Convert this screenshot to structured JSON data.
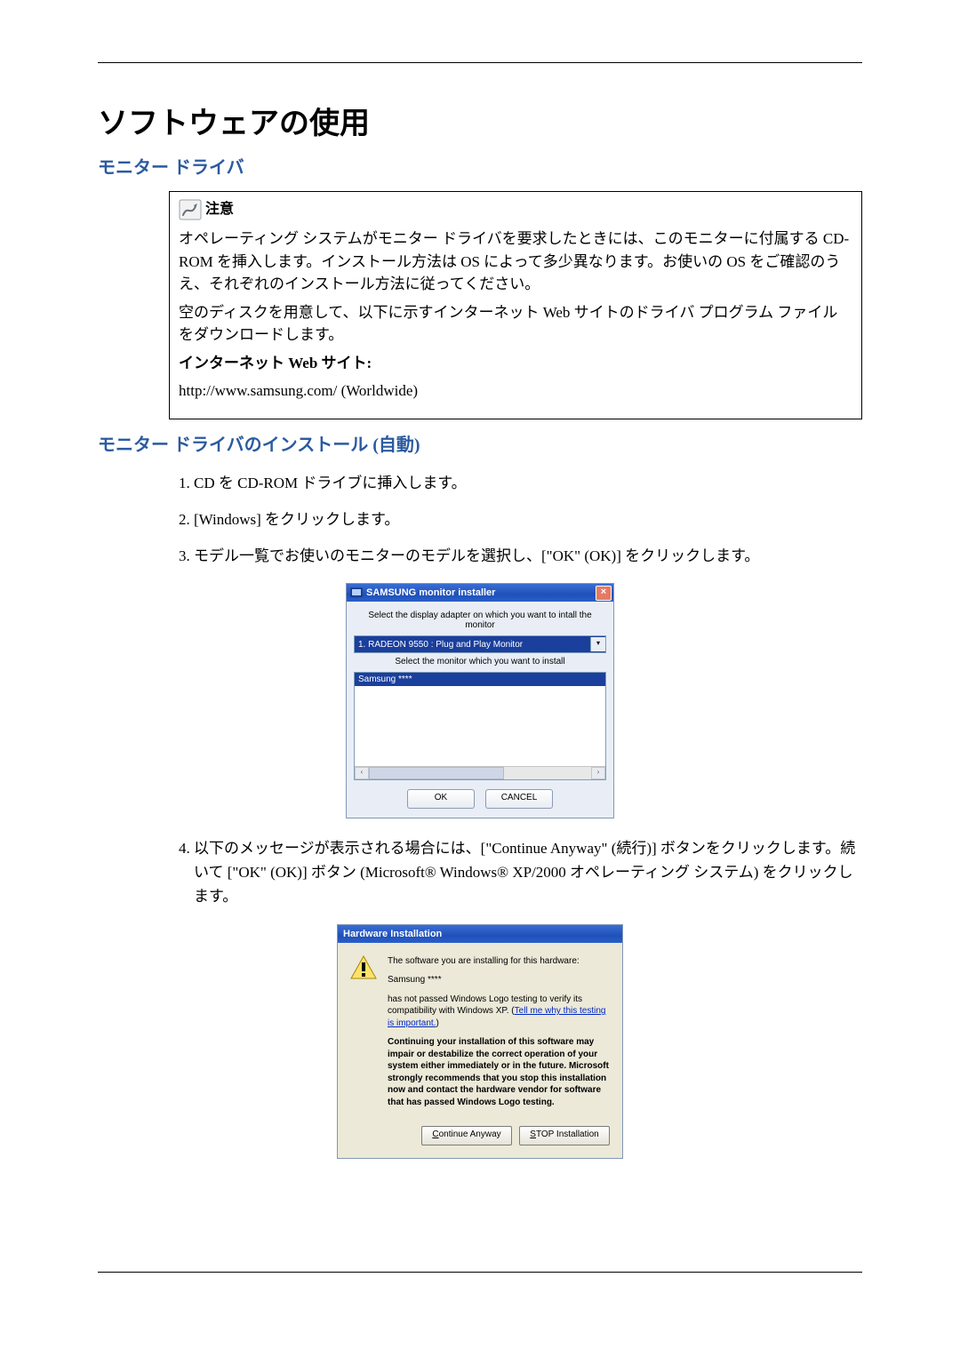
{
  "title": "ソフトウェアの使用",
  "h2a": "モニター ドライバ",
  "note": {
    "label": "注意",
    "p1": "オペレーティング システムがモニター ドライバを要求したときには、このモニターに付属する CD-ROM を挿入します。インストール方法は OS によって多少異なります。お使いの OS をご確認のうえ、それぞれのインストール方法に従ってください。",
    "p2": "空のディスクを用意して、以下に示すインターネット Web サイトのドライバ プログラム ファイルをダウンロードします。",
    "p3_bold": "インターネット Web サイト:",
    "p4": "http://www.samsung.com/ (Worldwide)"
  },
  "h2b": "モニター ドライバのインストール (自動)",
  "steps": {
    "s1": "CD を CD-ROM ドライブに挿入します。",
    "s2": "[Windows] をクリックします。",
    "s3": "モデル一覧でお使いのモニターのモデルを選択し、[\"OK\" (OK)] をクリックします。",
    "s4": "以下のメッセージが表示される場合には、[\"Continue Anyway\" (続行)] ボタンをクリックします。続いて [\"OK\" (OK)] ボタン (Microsoft® Windows® XP/2000 オペレーティング システム) をクリックします。"
  },
  "installer": {
    "title": "SAMSUNG monitor installer",
    "close": "×",
    "prompt1": "Select the display adapter on which you want to intall the monitor",
    "combo": "1. RADEON 9550 : Plug and Play Monitor",
    "prompt2": "Select the monitor which you want to install",
    "item": "Samsung ****",
    "ok": "OK",
    "cancel": "CANCEL",
    "scroll_left": "‹",
    "scroll_right": "›"
  },
  "hw": {
    "title": "Hardware Installation",
    "p1": "The software you are installing for this hardware:",
    "p2": "Samsung ****",
    "p3a": "has not passed Windows Logo testing to verify its compatibility with Windows XP. (",
    "link": "Tell me why this testing is important.",
    "p3b": ")",
    "p4": "Continuing your installation of this software may impair or destabilize the correct operation of your system either immediately or in the future. Microsoft strongly recommends that you stop this installation now and contact the hardware vendor for software that has passed Windows Logo testing.",
    "btn_continue_u": "C",
    "btn_continue_rest": "ontinue Anyway",
    "btn_stop_u": "S",
    "btn_stop_rest": "TOP Installation"
  }
}
